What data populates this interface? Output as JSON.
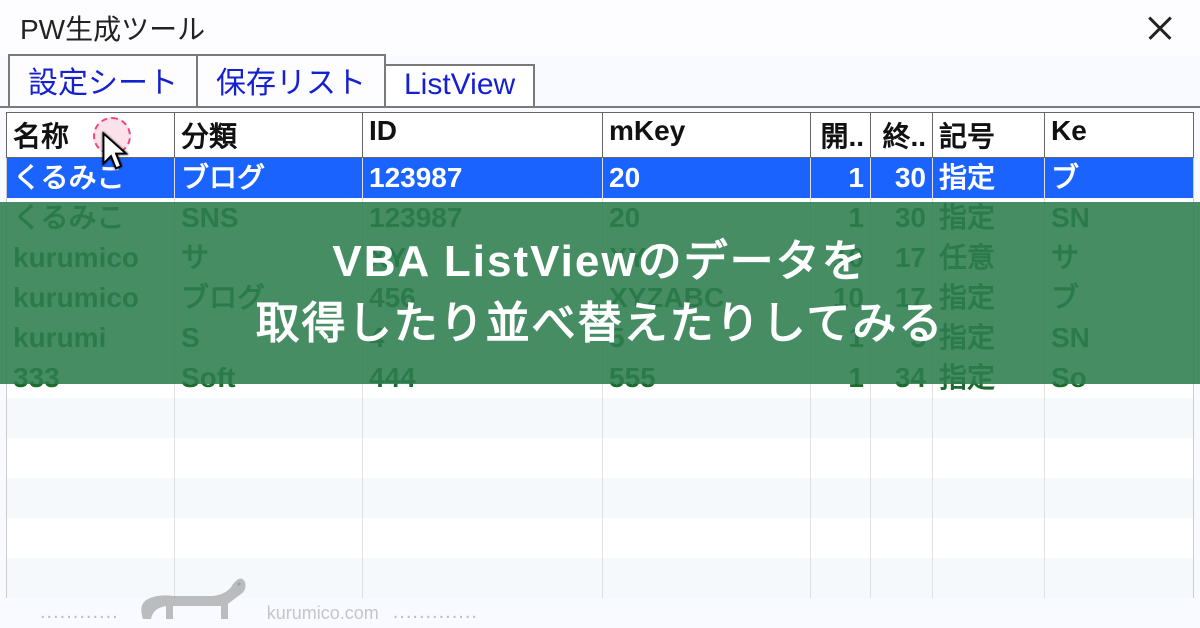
{
  "window": {
    "title": "PW生成ツール"
  },
  "tabs": [
    {
      "label": "設定シート",
      "active": false
    },
    {
      "label": "保存リスト",
      "active": false
    },
    {
      "label": "ListView",
      "active": true
    }
  ],
  "columns": [
    {
      "label": "名称"
    },
    {
      "label": "分類"
    },
    {
      "label": "ID"
    },
    {
      "label": "mKey"
    },
    {
      "label": "開.."
    },
    {
      "label": "終.."
    },
    {
      "label": "記号"
    },
    {
      "label": "Ke"
    }
  ],
  "rows": [
    {
      "selected": true,
      "cells": [
        "くるみこ",
        "ブログ",
        "123987",
        "20",
        "1",
        "30",
        "指定",
        "ブ"
      ]
    },
    {
      "selected": false,
      "cells": [
        "くるみこ",
        "SNS",
        "123987",
        "20",
        "1",
        "30",
        "指定",
        "SN"
      ]
    },
    {
      "selected": false,
      "cells": [
        "kurumico",
        "サ",
        "XY",
        "XY",
        "10",
        "17",
        "任意",
        "サ"
      ]
    },
    {
      "selected": false,
      "cells": [
        "kurumico",
        "ブログ",
        "456",
        "XYZABC",
        "10",
        "17",
        "指定",
        "ブ"
      ]
    },
    {
      "selected": false,
      "cells": [
        "kurumi",
        "S",
        "4",
        "5",
        "1",
        "3",
        "指定",
        "SN"
      ]
    },
    {
      "selected": false,
      "cells": [
        "333",
        "Soft",
        "444",
        "555",
        "1",
        "34",
        "指定",
        "So"
      ]
    }
  ],
  "overlay": {
    "line1": "VBA ListViewのデータを",
    "line2": "取得したり並べ替えたりしてみる"
  },
  "footer": {
    "watermark": "kurumico.com",
    "dots": "............",
    "dots2": "............."
  }
}
